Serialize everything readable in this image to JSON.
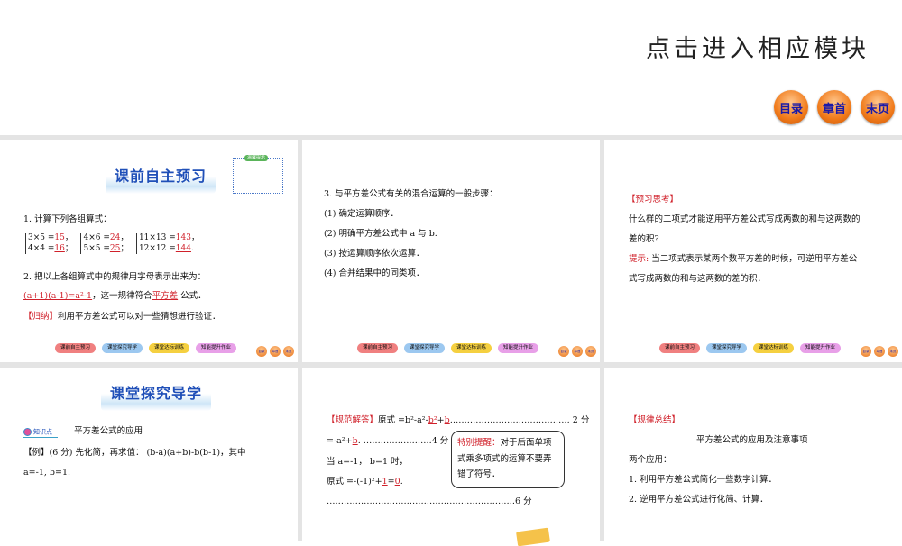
{
  "header": {
    "title": "点击进入相应模块",
    "nav": [
      "目录",
      "章首",
      "末页"
    ]
  },
  "footer_nav": {
    "pills": [
      "课前自主预习",
      "课堂探究导学",
      "课堂达标训练",
      "知能提升作业"
    ],
    "buttons": [
      "目录",
      "章首",
      "末页"
    ]
  },
  "slide1": {
    "banner": "课前自主预习",
    "tip_title": "温馨提示",
    "q1": "1. 计算下列各组算式：",
    "groups": [
      [
        "3×5 =",
        "15",
        "，",
        "4×4 =",
        "16",
        "；"
      ],
      [
        "4×6 =",
        "24",
        "，",
        "5×5 =",
        "25",
        "；"
      ],
      [
        "11×13 =",
        "143",
        "，",
        "12×12 =",
        "144",
        "."
      ]
    ],
    "q2": "2. 把以上各组算式中的规律用字母表示出来为：",
    "q2_answer": "(a+1)(a-1)=a²-1",
    "q2_mid": "，这一规律符合",
    "q2_blank": "平方差",
    "q2_end": "公式．",
    "summary_label": "【归纳】",
    "summary": "利用平方差公式可以对一些猜想进行验证．"
  },
  "slide2": {
    "lines": [
      "3. 与平方差公式有关的混合运算的一般步骤：",
      "(1) 确定运算顺序．",
      "(2) 明确平方差公式中 a 与 b.",
      "(3) 按运算顺序依次运算．",
      "(4) 合并结果中的同类项．"
    ]
  },
  "slide3": {
    "label": "【预习思考】",
    "question": "什么样的二项式才能逆用平方差公式写成两数的和与这两数的",
    "question2": "差的积?",
    "hint_label": "提示:",
    "hint": "当二项式表示某两个数平方差的时候，可逆用平方差公",
    "hint2": "式写成两数的和与这两数的差的积．"
  },
  "slide4": {
    "banner": "课堂探究导学",
    "kp_label": "知识点",
    "kp_title": "平方差公式的应用",
    "example": "【例】(6 分) 先化简，再求值： (b-a)(a+b)-b(b-1)，其中",
    "example2": "a=-1, b=1."
  },
  "slide5": {
    "label": "【规范解答】",
    "l1a": "原式 =b²-a²-",
    "l1b": "b²",
    "l1c": "+",
    "l1d": "b",
    "l1e": "…………………………………… 2 分",
    "l2a": "=-a²+",
    "l2b": "b",
    "l2c": ". ……………………4 分",
    "l3": "当 a=-1， b=1 时，",
    "l4a": "原式 =-(-1)²+",
    "l4b": "1",
    "l4c": "=",
    "l4d": "0",
    "l4e": ".",
    "l5": "…………………………………………………………6 分",
    "note_label": "特别提醒：",
    "note": "对于后面单项式乘多项式的运算不要弄错了符号．"
  },
  "slide6": {
    "label": "【规律总结】",
    "title": "平方差公式的应用及注意事项",
    "lines": [
      "两个应用：",
      "1. 利用平方差公式简化一些数字计算．",
      "2. 逆用平方差公式进行化简、计算．"
    ]
  },
  "colors": {
    "accent_red": "#d0202a",
    "banner_blue": "#1f4fb8",
    "nav_orange": "#f07a1a",
    "pill_colors": [
      "#f08080",
      "#9cc8f0",
      "#f5d040",
      "#e8a0e8"
    ]
  }
}
